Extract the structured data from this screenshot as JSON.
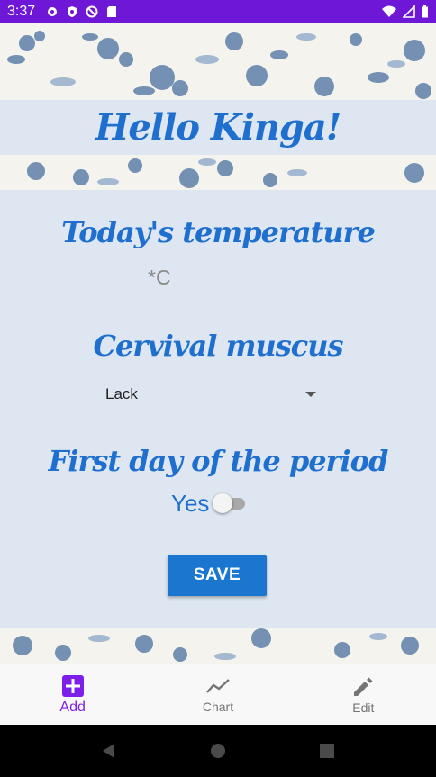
{
  "status_bar": {
    "time": "3:37",
    "left_icons": [
      "gear-icon",
      "shield-icon",
      "no-sync-icon",
      "sd-card-icon"
    ],
    "right_icons": [
      "wifi-icon",
      "signal-icon",
      "battery-icon"
    ],
    "color": "#6f17d6"
  },
  "greeting": "Hello Kinga!",
  "form": {
    "temperature_heading": "Today's temperature",
    "temperature_placeholder": "*C",
    "temperature_value": "",
    "mucus_heading": "Cervival muscus",
    "mucus_selected": "Lack",
    "period_heading": "First day of the period",
    "period_switch_label": "Yes",
    "period_switch_on": false,
    "save_label": "SAVE"
  },
  "bottom_nav": {
    "items": [
      {
        "label": "Add",
        "icon": "add-box-icon",
        "active": true
      },
      {
        "label": "Chart",
        "icon": "chart-icon",
        "active": false
      },
      {
        "label": "Edit",
        "icon": "pencil-icon",
        "active": false
      }
    ]
  },
  "system_nav": [
    "back-icon",
    "home-icon",
    "recents-icon"
  ],
  "colors": {
    "accent": "#1f6fcf",
    "panel": "#dde6f1",
    "button": "#1b76cf",
    "nav_active": "#7d1fe8"
  }
}
